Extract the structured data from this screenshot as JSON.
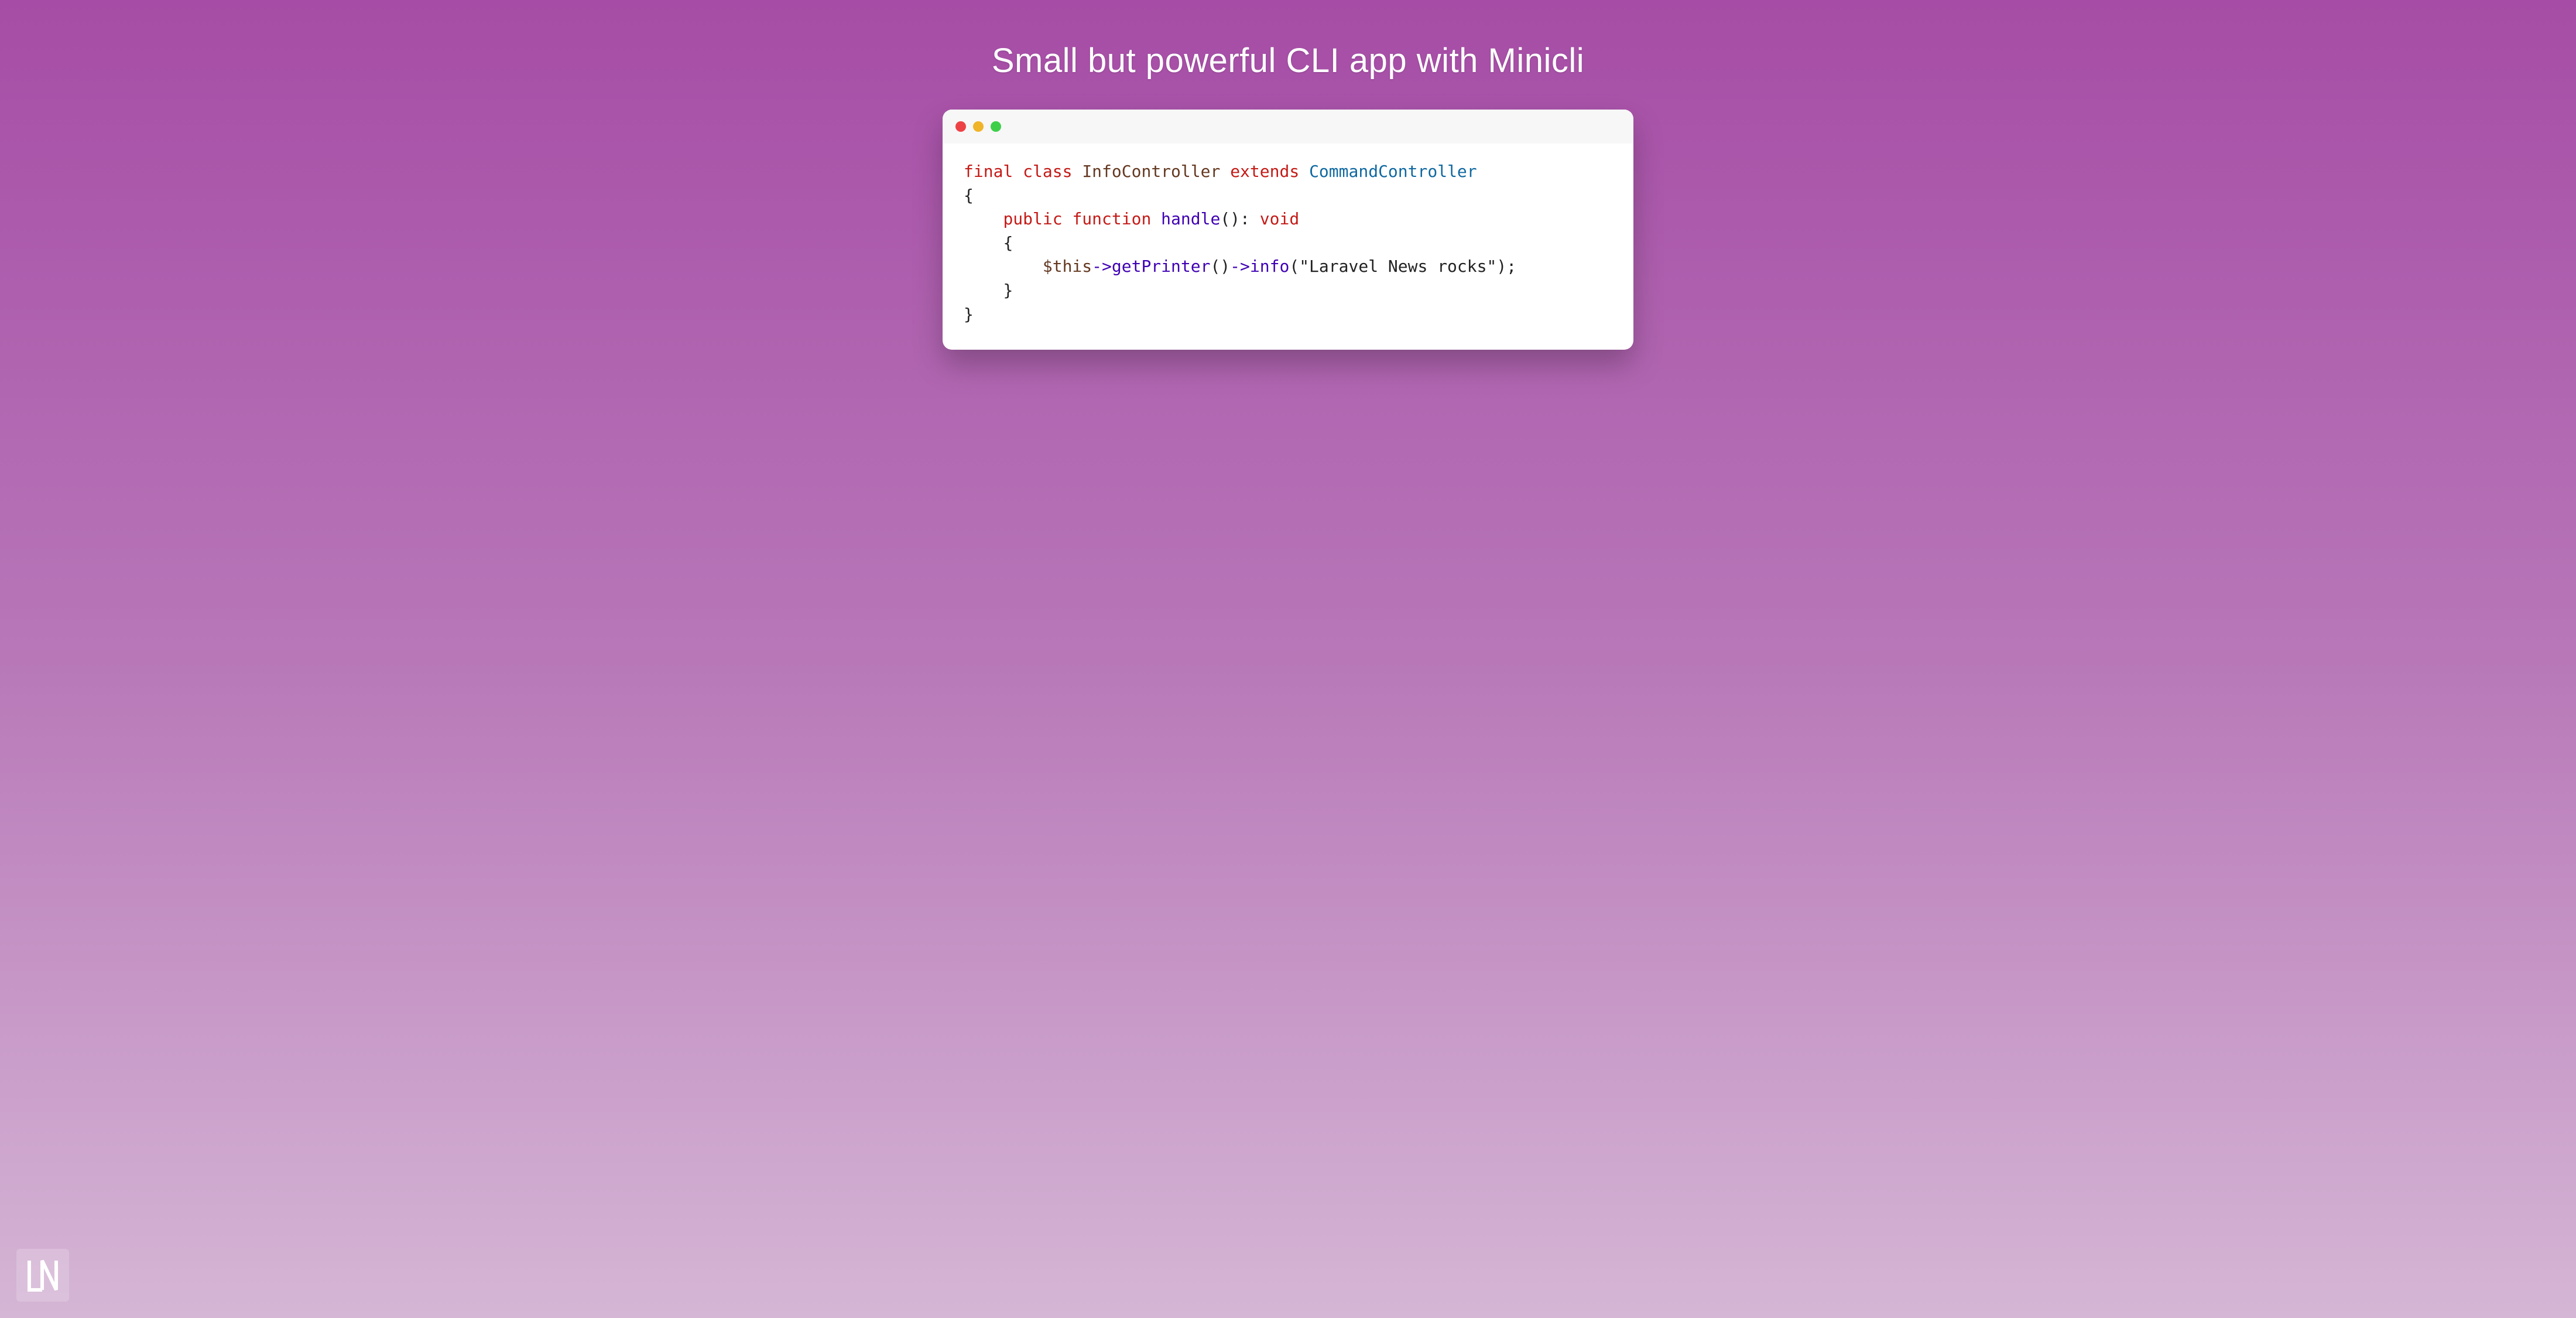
{
  "title": "Small but powerful CLI app with Minicli",
  "traffic_lights": {
    "red": "#ed4245",
    "yellow": "#f0b429",
    "green": "#3ecf4a"
  },
  "code": {
    "kw_final": "final",
    "kw_class": "class",
    "classname": "InfoController",
    "kw_extends": "extends",
    "superclass": "CommandController",
    "open_brace": "{",
    "kw_public": "public",
    "kw_function": "function",
    "method": "handle",
    "method_paren": "()",
    "colon": ":",
    "rettype": "void",
    "inner_open": "{",
    "this": "$this",
    "arrow1": "->",
    "call1": "getPrinter",
    "paren1": "()",
    "arrow2": "->",
    "call2": "info",
    "paren_open": "(",
    "string": "\"Laravel News rocks\"",
    "paren_close": ")",
    "semi": ";",
    "inner_close": "}",
    "close_brace": "}"
  },
  "logo_text": "LN"
}
